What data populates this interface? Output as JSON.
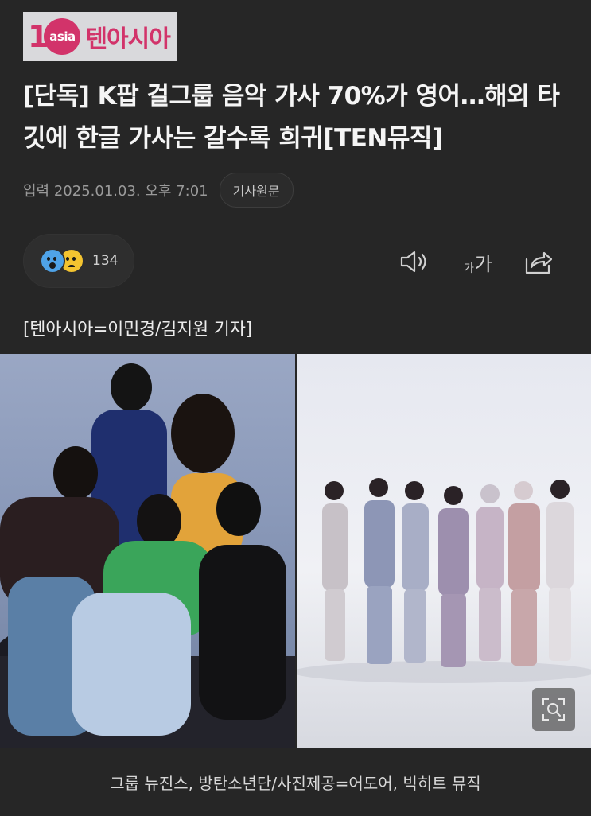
{
  "header": {
    "logo_mark_number": "1",
    "logo_mark_circle": "asia",
    "logo_text": "텐아시아",
    "brand_color": "#d2336a"
  },
  "article": {
    "headline": "[단독] K팝 걸그룹 음악 가사 70%가 영어…해외 타깃에 한글 가사는 갈수록 희귀[TEN뮤직]",
    "date": "입력 2025.01.03. 오후 7:01",
    "source_button": "기사원문",
    "reaction_count": "134",
    "font_size_label_small": "가",
    "font_size_label_large": "가",
    "byline": "[텐아시아=이민경/김지원 기자]",
    "photo_caption": "그룹 뉴진스, 방탄소년단/사진제공=어도어, 빅히트 뮤직"
  },
  "icons": {
    "reaction_1": "surprised-emoji-icon",
    "reaction_2": "sad-emoji-icon",
    "speaker": "speaker-icon",
    "font_size": "font-size-icon",
    "share": "share-icon",
    "zoom": "zoom-icon"
  }
}
